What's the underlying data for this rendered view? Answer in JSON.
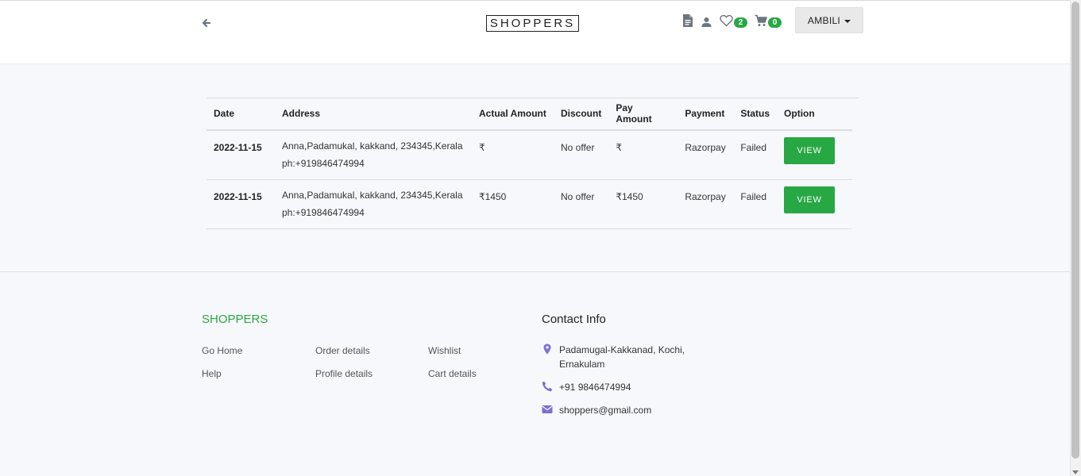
{
  "header": {
    "logo": "SHOPPERS",
    "wishlist_count": "2",
    "cart_count": "0",
    "user_label": "AMBILI"
  },
  "orders": {
    "columns": [
      "Date",
      "Address",
      "Actual Amount",
      "Discount",
      "Pay Amount",
      "Payment",
      "Status",
      "Option"
    ],
    "rows": [
      {
        "date": "2022-11-15",
        "address": "Anna,Padamukal, kakkand, 234345,Kerala",
        "phone": "ph:+919846474994",
        "actual_amount": "₹",
        "discount": "No offer",
        "pay_amount": "₹",
        "payment": "Razorpay",
        "status": "Failed",
        "option": "VIEW"
      },
      {
        "date": "2022-11-15",
        "address": "Anna,Padamukal, kakkand, 234345,Kerala",
        "phone": "ph:+919846474994",
        "actual_amount": "₹1450",
        "discount": "No offer",
        "pay_amount": "₹1450",
        "payment": "Razorpay",
        "status": "Failed",
        "option": "VIEW"
      }
    ]
  },
  "footer": {
    "brand": "SHOPPERS",
    "links": {
      "go_home": "Go Home",
      "order_details": "Order details",
      "wishlist": "Wishlist",
      "help": "Help",
      "profile_details": "Profile details",
      "cart_details": "Cart details"
    },
    "contact": {
      "title": "Contact Info",
      "address_line1": "Padamugal-Kakkanad, Kochi,",
      "address_line2": "Ernakulam",
      "phone": "+91 9846474994",
      "email": "shoppers@gmail.com"
    }
  },
  "colors": {
    "accent_green": "#28a745",
    "contact_icon": "#7b6fd6"
  }
}
